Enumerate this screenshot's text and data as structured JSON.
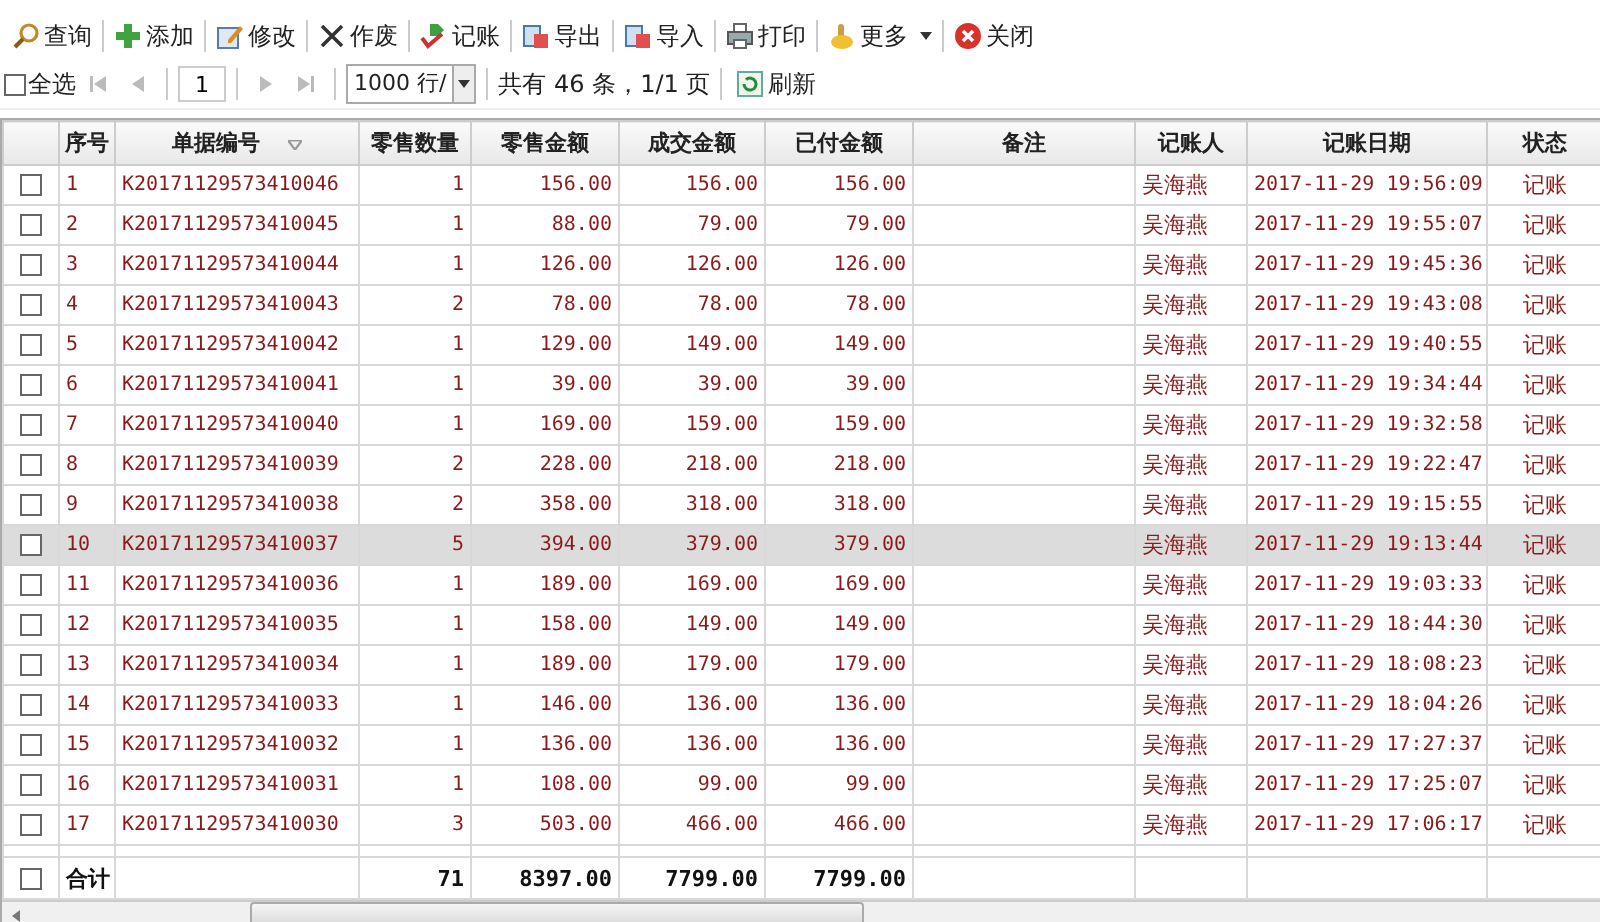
{
  "toolbar": [
    {
      "kind": "search",
      "label": "查询"
    },
    {
      "kind": "add",
      "label": "添加"
    },
    {
      "kind": "edit",
      "label": "修改"
    },
    {
      "kind": "void",
      "label": "作废"
    },
    {
      "kind": "post",
      "label": "记账"
    },
    {
      "kind": "export",
      "label": "导出"
    },
    {
      "kind": "import",
      "label": "导入"
    },
    {
      "kind": "print",
      "label": "打印"
    },
    {
      "kind": "more",
      "label": "更多"
    },
    {
      "kind": "close",
      "label": "关闭"
    }
  ],
  "pager": {
    "select_all": {
      "label": "全选",
      "checked": false
    },
    "page": "1",
    "page_size": "1000 行/",
    "summary": "共有 46 条，1/1 页",
    "refresh": "刷新"
  },
  "table": {
    "columns": [
      {
        "label": "序号",
        "sortable": false
      },
      {
        "label": "单据编号",
        "sortable": true
      },
      {
        "label": "零售数量",
        "sortable": false
      },
      {
        "label": "零售金额",
        "sortable": false
      },
      {
        "label": "成交金额",
        "sortable": false
      },
      {
        "label": "已付金额",
        "sortable": false
      },
      {
        "label": "备注",
        "sortable": false
      },
      {
        "label": "记账人",
        "sortable": false
      },
      {
        "label": "记账日期",
        "sortable": false
      },
      {
        "label": "状态",
        "sortable": false
      }
    ],
    "rows": [
      {
        "checked": false,
        "selected": false,
        "cells": [
          "1",
          "K20171129573410046",
          "1",
          "156.00",
          "156.00",
          "156.00",
          null,
          "吴海燕",
          "2017-11-29 19:56:09",
          "记账"
        ]
      },
      {
        "checked": false,
        "selected": false,
        "cells": [
          "2",
          "K20171129573410045",
          "1",
          "88.00",
          "79.00",
          "79.00",
          null,
          "吴海燕",
          "2017-11-29 19:55:07",
          "记账"
        ]
      },
      {
        "checked": false,
        "selected": false,
        "cells": [
          "3",
          "K20171129573410044",
          "1",
          "126.00",
          "126.00",
          "126.00",
          null,
          "吴海燕",
          "2017-11-29 19:45:36",
          "记账"
        ]
      },
      {
        "checked": false,
        "selected": false,
        "cells": [
          "4",
          "K20171129573410043",
          "2",
          "78.00",
          "78.00",
          "78.00",
          null,
          "吴海燕",
          "2017-11-29 19:43:08",
          "记账"
        ]
      },
      {
        "checked": false,
        "selected": false,
        "cells": [
          "5",
          "K20171129573410042",
          "1",
          "129.00",
          "149.00",
          "149.00",
          null,
          "吴海燕",
          "2017-11-29 19:40:55",
          "记账"
        ]
      },
      {
        "checked": false,
        "selected": false,
        "cells": [
          "6",
          "K20171129573410041",
          "1",
          "39.00",
          "39.00",
          "39.00",
          null,
          "吴海燕",
          "2017-11-29 19:34:44",
          "记账"
        ]
      },
      {
        "checked": false,
        "selected": false,
        "cells": [
          "7",
          "K20171129573410040",
          "1",
          "169.00",
          "159.00",
          "159.00",
          null,
          "吴海燕",
          "2017-11-29 19:32:58",
          "记账"
        ]
      },
      {
        "checked": false,
        "selected": false,
        "cells": [
          "8",
          "K20171129573410039",
          "2",
          "228.00",
          "218.00",
          "218.00",
          null,
          "吴海燕",
          "2017-11-29 19:22:47",
          "记账"
        ]
      },
      {
        "checked": false,
        "selected": false,
        "cells": [
          "9",
          "K20171129573410038",
          "2",
          "358.00",
          "318.00",
          "318.00",
          null,
          "吴海燕",
          "2017-11-29 19:15:55",
          "记账"
        ]
      },
      {
        "checked": false,
        "selected": true,
        "cells": [
          "10",
          "K20171129573410037",
          "5",
          "394.00",
          "379.00",
          "379.00",
          null,
          "吴海燕",
          "2017-11-29 19:13:44",
          "记账"
        ]
      },
      {
        "checked": false,
        "selected": false,
        "cells": [
          "11",
          "K20171129573410036",
          "1",
          "189.00",
          "169.00",
          "169.00",
          null,
          "吴海燕",
          "2017-11-29 19:03:33",
          "记账"
        ]
      },
      {
        "checked": false,
        "selected": false,
        "cells": [
          "12",
          "K20171129573410035",
          "1",
          "158.00",
          "149.00",
          "149.00",
          null,
          "吴海燕",
          "2017-11-29 18:44:30",
          "记账"
        ]
      },
      {
        "checked": false,
        "selected": false,
        "cells": [
          "13",
          "K20171129573410034",
          "1",
          "189.00",
          "179.00",
          "179.00",
          null,
          "吴海燕",
          "2017-11-29 18:08:23",
          "记账"
        ]
      },
      {
        "checked": false,
        "selected": false,
        "cells": [
          "14",
          "K20171129573410033",
          "1",
          "146.00",
          "136.00",
          "136.00",
          null,
          "吴海燕",
          "2017-11-29 18:04:26",
          "记账"
        ]
      },
      {
        "checked": false,
        "selected": false,
        "cells": [
          "15",
          "K20171129573410032",
          "1",
          "136.00",
          "136.00",
          "136.00",
          null,
          "吴海燕",
          "2017-11-29 17:27:37",
          "记账"
        ]
      },
      {
        "checked": false,
        "selected": false,
        "cells": [
          "16",
          "K20171129573410031",
          "1",
          "108.00",
          "99.00",
          "99.00",
          null,
          "吴海燕",
          "2017-11-29 17:25:07",
          "记账"
        ]
      },
      {
        "checked": false,
        "selected": false,
        "cells": [
          "17",
          "K20171129573410030",
          "3",
          "503.00",
          "466.00",
          "466.00",
          null,
          "吴海燕",
          "2017-11-29 17:06:17",
          "记账"
        ]
      }
    ],
    "total": {
      "checked": false,
      "cells": [
        "合计",
        null,
        "71",
        "8397.00",
        "7799.00",
        "7799.00",
        null,
        null,
        null,
        null
      ]
    }
  }
}
